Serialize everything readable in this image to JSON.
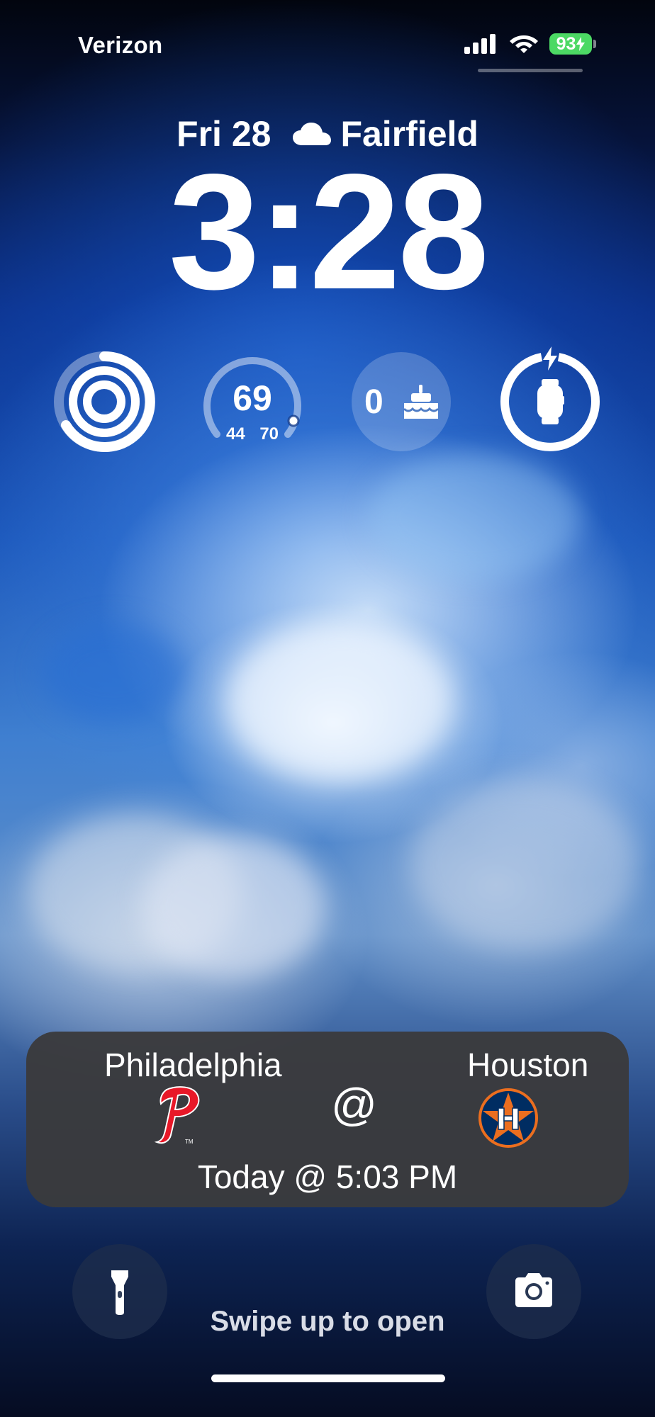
{
  "status_bar": {
    "carrier": "Verizon",
    "battery_level": "93",
    "battery_charging": true,
    "battery_color": "#4cd964",
    "signal_bars": 4,
    "wifi": true
  },
  "date_line": {
    "date": "Fri 28",
    "weather_icon": "cloud-icon",
    "location": "Fairfield"
  },
  "clock": {
    "time": "3:28"
  },
  "widgets": {
    "activity": {
      "icon": "activity-rings-icon"
    },
    "weather": {
      "temperature": "69",
      "low_high": "44 70"
    },
    "birthdays": {
      "count": "0",
      "icon": "cake-icon"
    },
    "watch_battery": {
      "icon": "watch-icon",
      "charging_icon": "bolt-icon"
    }
  },
  "game": {
    "away_team": "Philadelphia",
    "home_team": "Houston",
    "separator": "@",
    "time": "Today @ 5:03 PM",
    "away_logo": "phillies-logo",
    "home_logo": "astros-logo",
    "away_color": "#e81828",
    "home_color": "#eb6e1f"
  },
  "bottom": {
    "flashlight_icon": "flashlight-icon",
    "camera_icon": "camera-icon",
    "swipe_hint": "Swipe up to open"
  }
}
